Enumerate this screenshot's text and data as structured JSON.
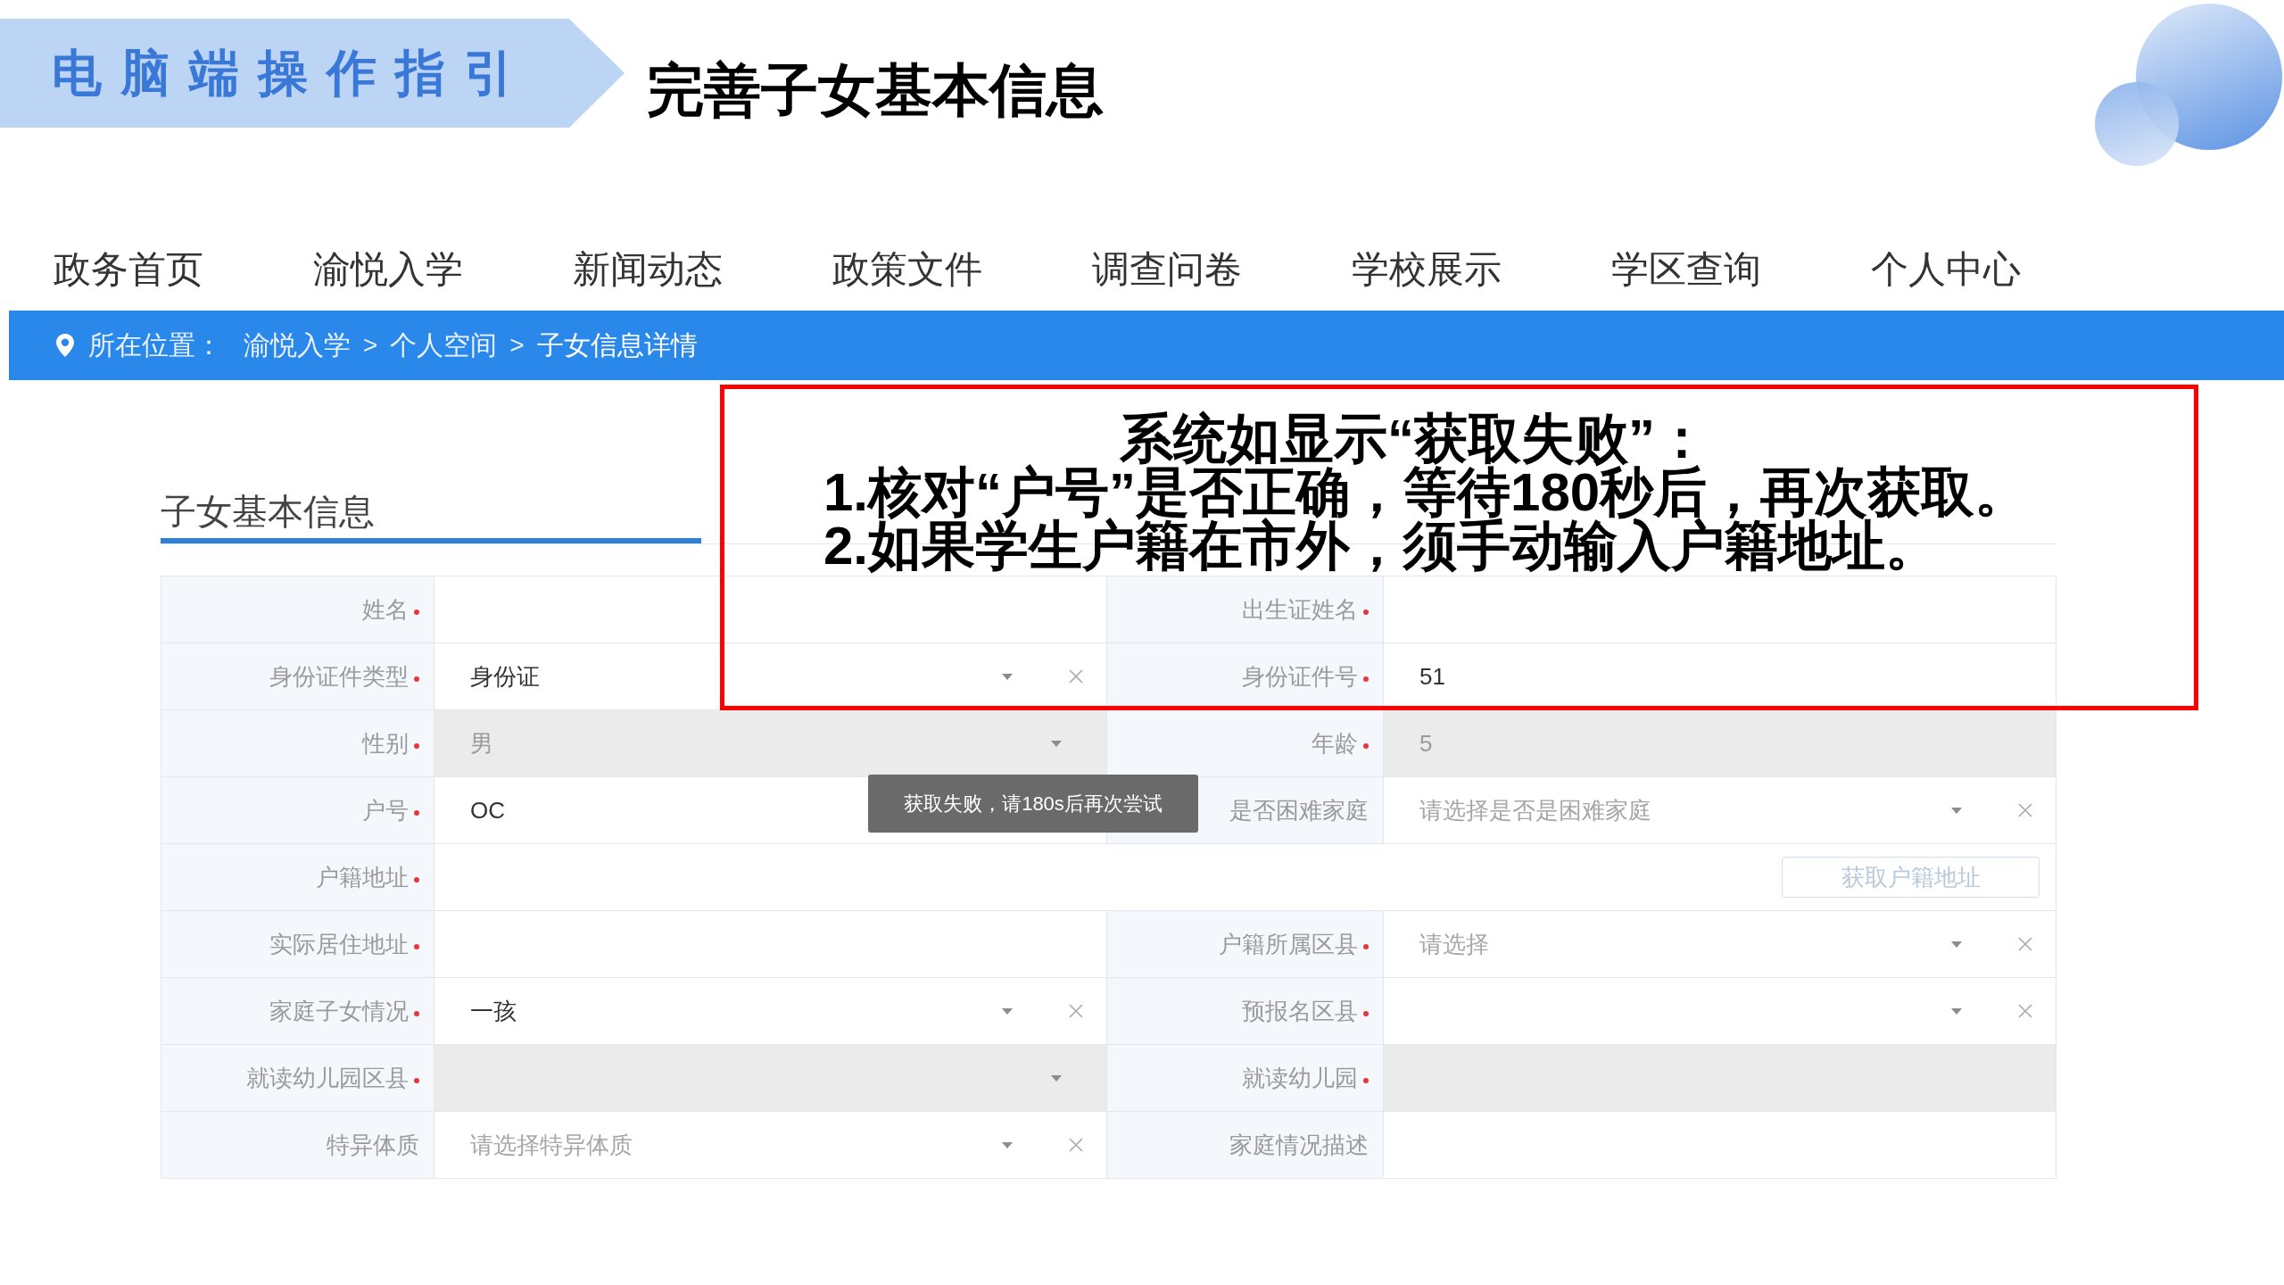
{
  "slide": {
    "banner": "电脑端操作指引",
    "title": "完善子女基本信息"
  },
  "nav": {
    "items": [
      "政务首页",
      "渝悦入学",
      "新闻动态",
      "政策文件",
      "调查问卷",
      "学校展示",
      "学区查询",
      "个人中心"
    ]
  },
  "breadcrumb": {
    "label": "所在位置：",
    "crumbs": [
      {
        "kind": "link",
        "text": "渝悦入学"
      },
      {
        "kind": "separator",
        "text": ">"
      },
      {
        "kind": "link",
        "text": "个人空间"
      },
      {
        "kind": "separator",
        "text": ">"
      },
      {
        "kind": "current",
        "text": "子女信息详情"
      }
    ]
  },
  "form": {
    "title": "子女基本信息",
    "rows": [
      {
        "cells": [
          {
            "label": "姓名",
            "required": true,
            "kind": "text",
            "disabled": false
          },
          {
            "label": "出生证姓名",
            "required": true,
            "kind": "text",
            "disabled": false
          }
        ]
      },
      {
        "cells": [
          {
            "label": "身份证件类型",
            "required": true,
            "kind": "select",
            "value": "身份证",
            "disabled": false,
            "clearable": true
          },
          {
            "label": "身份证件号",
            "required": true,
            "kind": "text",
            "value": "51",
            "disabled": false
          }
        ]
      },
      {
        "cells": [
          {
            "label": "性别",
            "required": true,
            "kind": "select",
            "value": "男",
            "disabled": true,
            "clearable": false
          },
          {
            "label": "年龄",
            "required": true,
            "kind": "text",
            "value": "5",
            "disabled": true
          }
        ]
      },
      {
        "cells": [
          {
            "label": "户号",
            "required": true,
            "kind": "text",
            "value": "OC",
            "disabled": false
          },
          {
            "label": "是否困难家庭",
            "required": false,
            "kind": "select",
            "placeholder": "请选择是否是困难家庭",
            "disabled": false,
            "clearable": true
          }
        ]
      },
      {
        "cells": [
          {
            "label": "户籍地址",
            "required": true,
            "kind": "text",
            "disabled": false,
            "button": {
              "text": "获取户籍地址",
              "disabled": true
            }
          }
        ]
      },
      {
        "cells": [
          {
            "label": "实际居住地址",
            "required": true,
            "kind": "text",
            "disabled": false
          },
          {
            "label": "户籍所属区县",
            "required": true,
            "kind": "select",
            "placeholder": "请选择",
            "disabled": false,
            "clearable": true
          }
        ]
      },
      {
        "cells": [
          {
            "label": "家庭子女情况",
            "required": true,
            "kind": "select",
            "value": "一孩",
            "disabled": false,
            "clearable": true
          },
          {
            "label": "预报名区县",
            "required": true,
            "kind": "select",
            "disabled": false,
            "clearable": true
          }
        ]
      },
      {
        "cells": [
          {
            "label": "就读幼儿园区县",
            "required": true,
            "kind": "select",
            "disabled": true,
            "clearable": false
          },
          {
            "label": "就读幼儿园",
            "required": true,
            "kind": "text",
            "disabled": true
          }
        ]
      },
      {
        "cells": [
          {
            "label": "特异体质",
            "required": false,
            "kind": "select",
            "placeholder": "请选择特异体质",
            "disabled": false,
            "clearable": true
          },
          {
            "label": "家庭情况描述",
            "required": false,
            "kind": "text",
            "disabled": false
          }
        ]
      }
    ]
  },
  "toast": {
    "text": "获取失败，请180s后再次尝试"
  },
  "callout": {
    "heading": "系统如显示“获取失败”：",
    "lines": [
      "1.核对“户号”是否正确，等待180秒后，再次获取。",
      "2.如果学生户籍在市外，须手动输入户籍地址。"
    ]
  }
}
